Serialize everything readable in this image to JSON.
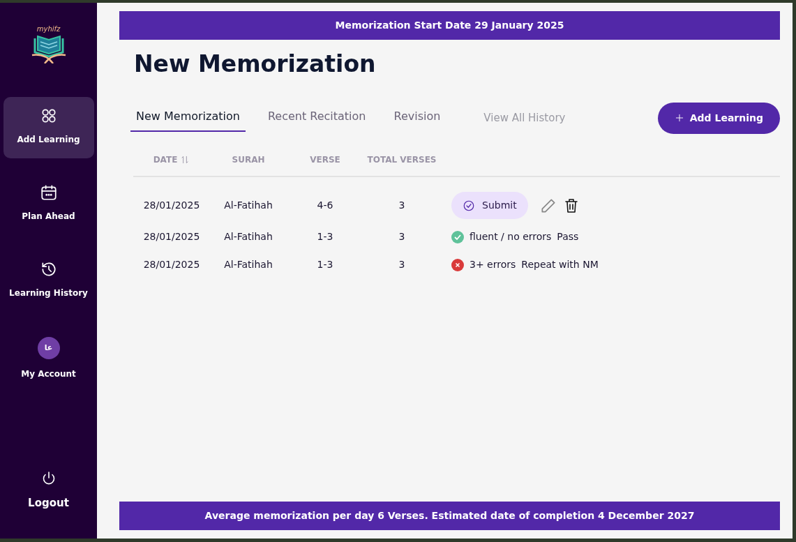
{
  "sidebar": {
    "logo_text": "myhifz",
    "items": [
      {
        "label": "Add Learning",
        "kind": "grid",
        "selected": true
      },
      {
        "label": "Plan Ahead",
        "kind": "calendar",
        "selected": false
      },
      {
        "label": "Learning History",
        "kind": "history",
        "selected": false
      },
      {
        "label": "My Account",
        "kind": "avatar",
        "avatar_text": "عا",
        "selected": false
      }
    ],
    "logout": {
      "label": "Logout"
    }
  },
  "top_banner": "Memorization Start Date 29 January 2025",
  "page_title": "New Memorization",
  "tabs": [
    {
      "label": "New Memorization",
      "selected": true
    },
    {
      "label": "Recent Recitation",
      "selected": false
    },
    {
      "label": "Revision",
      "selected": false
    }
  ],
  "history_link": "View All History",
  "add_button": {
    "label": "Add Learning"
  },
  "table": {
    "columns": [
      "DATE",
      "SURAH",
      "VERSE",
      "TOTAL VERSES"
    ],
    "rows": [
      {
        "kind": "pending",
        "date": "28/01/2025",
        "surah": "Al-Fatihah",
        "verse": "4-6",
        "total": "3",
        "action": "Submit"
      },
      {
        "kind": "pass",
        "date": "28/01/2025",
        "surah": "Al-Fatihah",
        "verse": "1-3",
        "total": "3",
        "result": "fluent / no errors",
        "outcome": "Pass"
      },
      {
        "kind": "fail",
        "date": "28/01/2025",
        "surah": "Al-Fatihah",
        "verse": "1-3",
        "total": "3",
        "result": "3+ errors",
        "outcome": "Repeat with NM"
      }
    ]
  },
  "bottom_banner": "Average memorization per day 6 Verses. Estimated date of completion 4 December 2027"
}
